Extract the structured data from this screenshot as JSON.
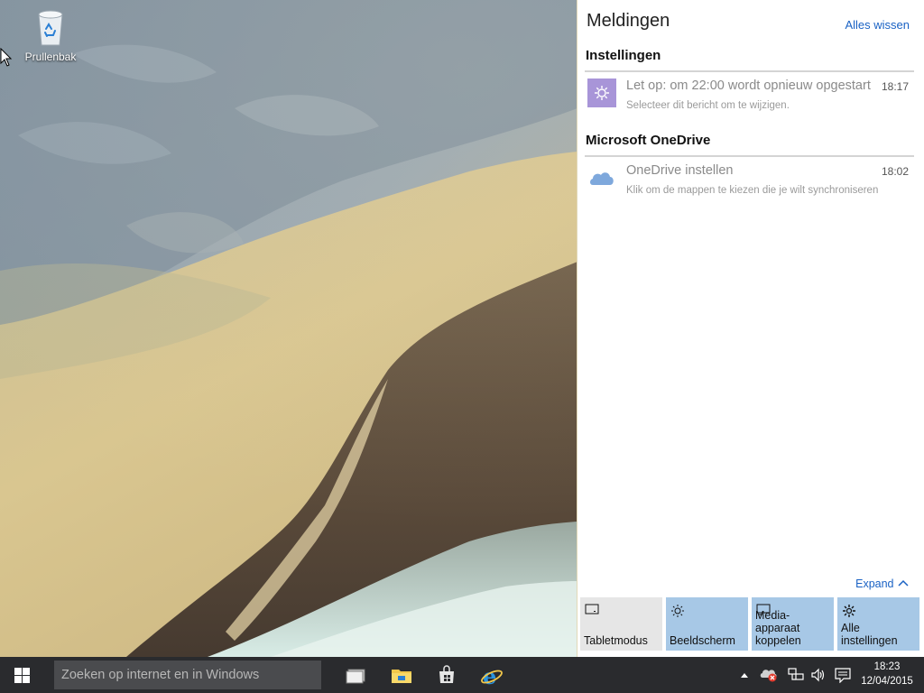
{
  "desktop": {
    "icons": [
      {
        "label": "Prullenbak",
        "icon": "recycle-bin-icon"
      }
    ]
  },
  "action_center": {
    "title": "Meldingen",
    "clear_all": "Alles wissen",
    "groups": [
      {
        "header": "Instellingen",
        "notifications": [
          {
            "icon": "settings-gear-icon",
            "title": "Let op: om 22:00 wordt opnieuw opgestart",
            "time": "18:17",
            "body": "Selecteer dit bericht om te wijzigen."
          }
        ]
      },
      {
        "header": "Microsoft OneDrive",
        "notifications": [
          {
            "icon": "onedrive-cloud-icon",
            "title": "OneDrive instellen",
            "time": "18:02",
            "body": "Klik om de mappen te kiezen die je wilt synchroniseren"
          }
        ]
      }
    ],
    "expand_label": "Expand",
    "quick_actions": [
      {
        "label": "Tabletmodus",
        "icon": "tablet-mode-icon",
        "active": false
      },
      {
        "label": "Beeldscherm",
        "icon": "brightness-icon",
        "active": true
      },
      {
        "label": "Media-apparaat koppelen",
        "icon": "connect-display-icon",
        "active": true
      },
      {
        "label": "Alle instellingen",
        "icon": "settings-gear-icon",
        "active": true
      }
    ],
    "accent_color": "#a7c8e6",
    "link_color": "#1a62c4"
  },
  "taskbar": {
    "search_placeholder": "Zoeken op internet en in Windows",
    "pinned_apps": [
      {
        "name": "Taakweergave",
        "icon": "task-view-icon"
      },
      {
        "name": "Verkenner",
        "icon": "file-explorer-icon"
      },
      {
        "name": "Store",
        "icon": "store-icon"
      },
      {
        "name": "Internet Explorer",
        "icon": "internet-explorer-icon"
      }
    ],
    "tray_icons": [
      "show-hidden-icons-chevron",
      "onedrive-error-icon",
      "network-icon",
      "volume-icon",
      "action-center-icon"
    ],
    "clock": {
      "time": "18:23",
      "date": "12/04/2015"
    },
    "background_color": "#2a2b2e"
  }
}
